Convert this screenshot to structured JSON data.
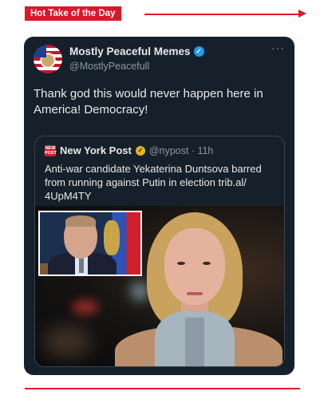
{
  "banner": {
    "label": "Hot Take of the Day"
  },
  "tweet": {
    "display_name": "Mostly Peaceful Memes",
    "handle": "@MostlyPeacefull",
    "more_label": "···",
    "verified_icon": "verified-badge-icon",
    "text": "Thank god this would never happen here in America! Democracy!",
    "quote": {
      "logo_text": "NEW YORK POST",
      "display_name": "New York Post",
      "verified_icon": "gold-verified-badge-icon",
      "handle_time": "@nypost · 11h",
      "text": "Anti-war candidate Yekaterina Duntsova barred from running against Putin in election trib.al/ 4UpM4TY"
    }
  },
  "colors": {
    "accent_red": "#d7192a",
    "card_bg": "#15202b",
    "verified_blue": "#1d9bf0",
    "gold": "#e2b719"
  }
}
